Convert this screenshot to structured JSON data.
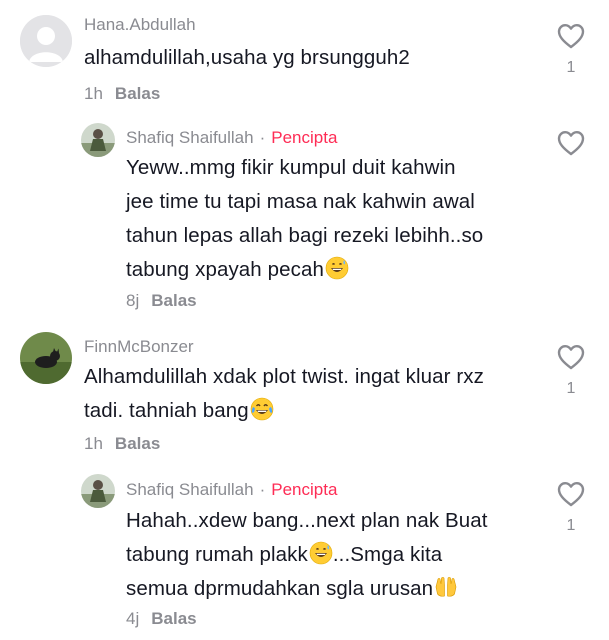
{
  "comments": [
    {
      "username": "Hana.Abdullah",
      "text": "alhamdulillah,usaha yg brsungguh2",
      "time": "1h",
      "reply": "Balas",
      "likes": "1",
      "avatar": "default-avatar-icon"
    },
    {
      "username": "Shafiq Shaifullah",
      "badge_sep": "·",
      "badge": "Pencipta",
      "text": "Yeww..mmg fikir kumpul duit kahwin\njee time tu tapi masa nak kahwin awal\ntahun lepas allah bagi rezeki lebihh..so\ntabung xpayah pecah",
      "emoji": "grinning-sweat-emoji",
      "time": "8j",
      "reply": "Balas",
      "likes": ""
    },
    {
      "username": "FinnMcBonzer",
      "text": "Alhamdulillah xdak plot twist. ingat kluar rxz\ntadi. tahniah bang",
      "emoji": "tears-of-joy-emoji",
      "time": "1h",
      "reply": "Balas",
      "likes": "1"
    },
    {
      "username": "Shafiq Shaifullah",
      "badge_sep": "·",
      "badge": "Pencipta",
      "text_a": "Hahah..xdew bang...next plan nak Buat\ntabung rumah plakk",
      "text_b": "...Smga kita\nsemua dprmudahkan sgla urusan",
      "emoji": "grinning-sweat-emoji",
      "emoji2": "raised-hands-emoji",
      "time": "4j",
      "reply": "Balas",
      "likes": "1"
    }
  ],
  "colors": {
    "text": "#161823",
    "secondary": "#8a8b91",
    "creator": "#fe2c55"
  }
}
